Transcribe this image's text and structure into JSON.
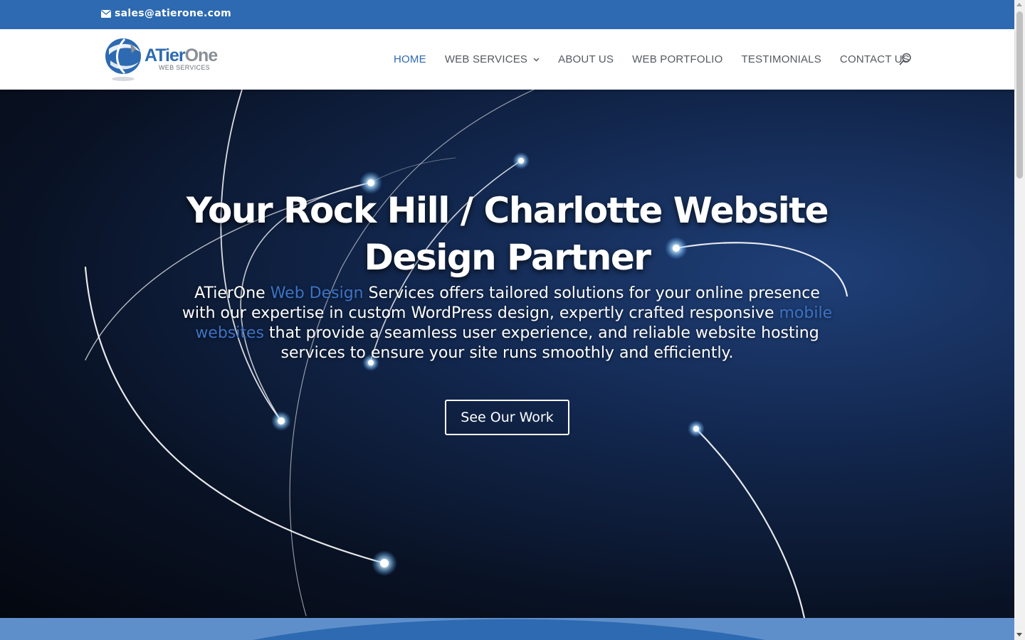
{
  "topbar": {
    "email": "sales@atierone.com",
    "email_icon": "envelope-icon"
  },
  "logo": {
    "name_part1": "ATier",
    "name_part2": "One",
    "subtitle": "WEB SERVICES",
    "colors": {
      "primary": "#2d6ab1",
      "secondary": "#8a8f96"
    }
  },
  "nav": {
    "items": [
      {
        "label": "HOME",
        "active": true
      },
      {
        "label": "WEB SERVICES",
        "has_dropdown": true
      },
      {
        "label": "ABOUT US"
      },
      {
        "label": "WEB PORTFOLIO"
      },
      {
        "label": "TESTIMONIALS"
      },
      {
        "label": "CONTACT US"
      }
    ],
    "search_icon": "search-icon"
  },
  "hero": {
    "title_line1": "Your Rock Hill / Charlotte Website",
    "title_line2": "Design Partner",
    "desc_part1": "ATierOne ",
    "desc_link1": "Web Design",
    "desc_part2": " Services offers tailored solutions for your online presence with our expertise in custom WordPress design, expertly crafted responsive ",
    "desc_link2": "mobile websites",
    "desc_part3": " that provide a seamless user experience, and reliable website hosting services to ensure your site runs smoothly and efficiently.",
    "cta_label": "See Our Work"
  },
  "colors": {
    "accent": "#2d6ab1",
    "link": "#3b73c6",
    "band": "#5f8fcb"
  }
}
